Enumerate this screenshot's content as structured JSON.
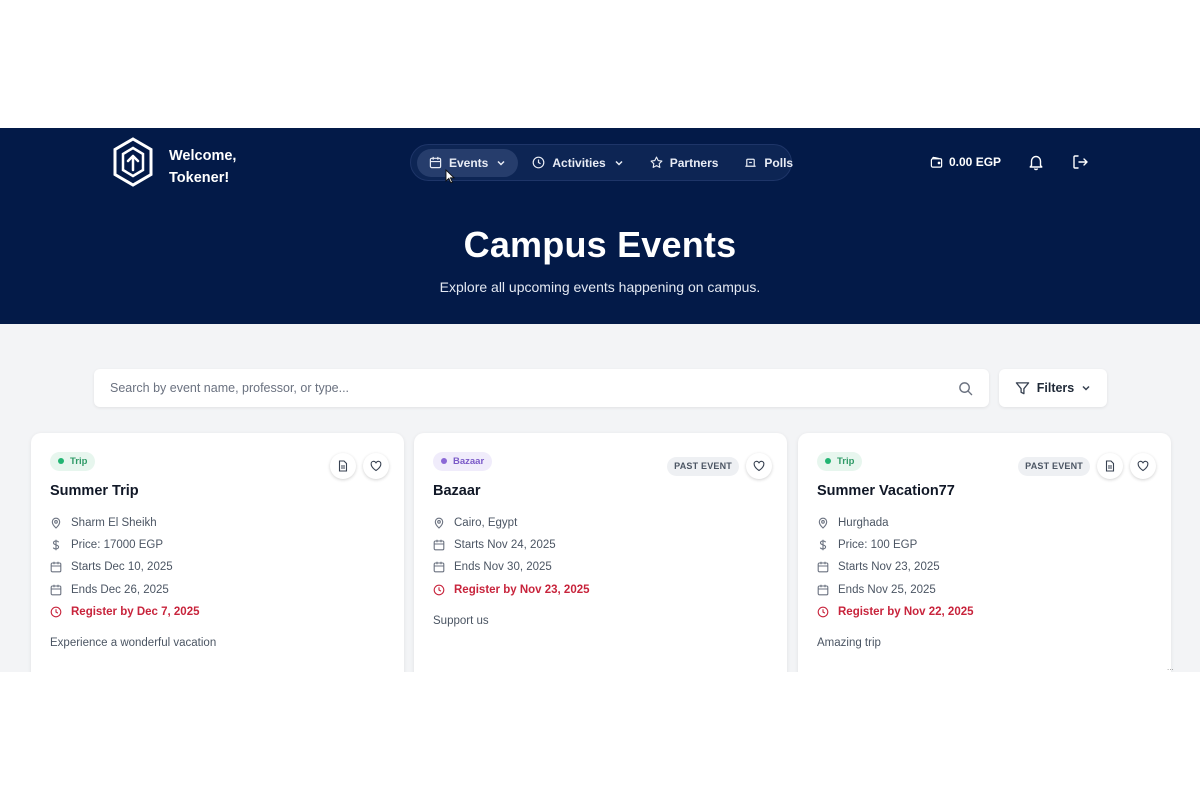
{
  "header": {
    "welcome_line1": "Welcome,",
    "welcome_line2": "Tokener!",
    "nav": [
      {
        "label": "Events",
        "icon": "calendar-icon",
        "dropdown": true,
        "active": true
      },
      {
        "label": "Activities",
        "icon": "clock-icon",
        "dropdown": true,
        "active": false
      },
      {
        "label": "Partners",
        "icon": "star-icon",
        "dropdown": false,
        "active": false
      },
      {
        "label": "Polls",
        "icon": "poll-icon",
        "dropdown": false,
        "active": false
      }
    ],
    "wallet_balance": "0.00 EGP"
  },
  "hero": {
    "title": "Campus Events",
    "subtitle": "Explore all upcoming events happening on campus."
  },
  "search": {
    "placeholder": "Search by event name, professor, or type...",
    "filters_label": "Filters"
  },
  "cards": [
    {
      "badge": "Trip",
      "badge_type": "trip",
      "past_label": "",
      "title": "Summer Trip",
      "location": "Sharm El Sheikh",
      "price": "Price: 17000 EGP",
      "starts": "Starts Dec 10, 2025",
      "ends": "Ends Dec 26, 2025",
      "register_by": "Register by Dec 7, 2025",
      "description": "Experience a wonderful vacation"
    },
    {
      "badge": "Bazaar",
      "badge_type": "bazaar",
      "past_label": "PAST EVENT",
      "title": "Bazaar",
      "location": "Cairo, Egypt",
      "starts": "Starts Nov 24, 2025",
      "ends": "Ends Nov 30, 2025",
      "register_by": "Register by Nov 23, 2025",
      "description": "Support us"
    },
    {
      "badge": "Trip",
      "badge_type": "trip",
      "past_label": "PAST EVENT",
      "title": "Summer Vacation77",
      "location": "Hurghada",
      "price": "Price: 100 EGP",
      "starts": "Starts Nov 23, 2025",
      "ends": "Ends Nov 25, 2025",
      "register_by": "Register by Nov 22, 2025",
      "description": "Amazing trip"
    }
  ],
  "colors": {
    "header_bg": "#031a48",
    "page_bg": "#f3f4f6",
    "register_red": "#c8243c",
    "trip_green": "#22b573",
    "bazaar_purple": "#8b68d6"
  },
  "overlay_text": "..."
}
